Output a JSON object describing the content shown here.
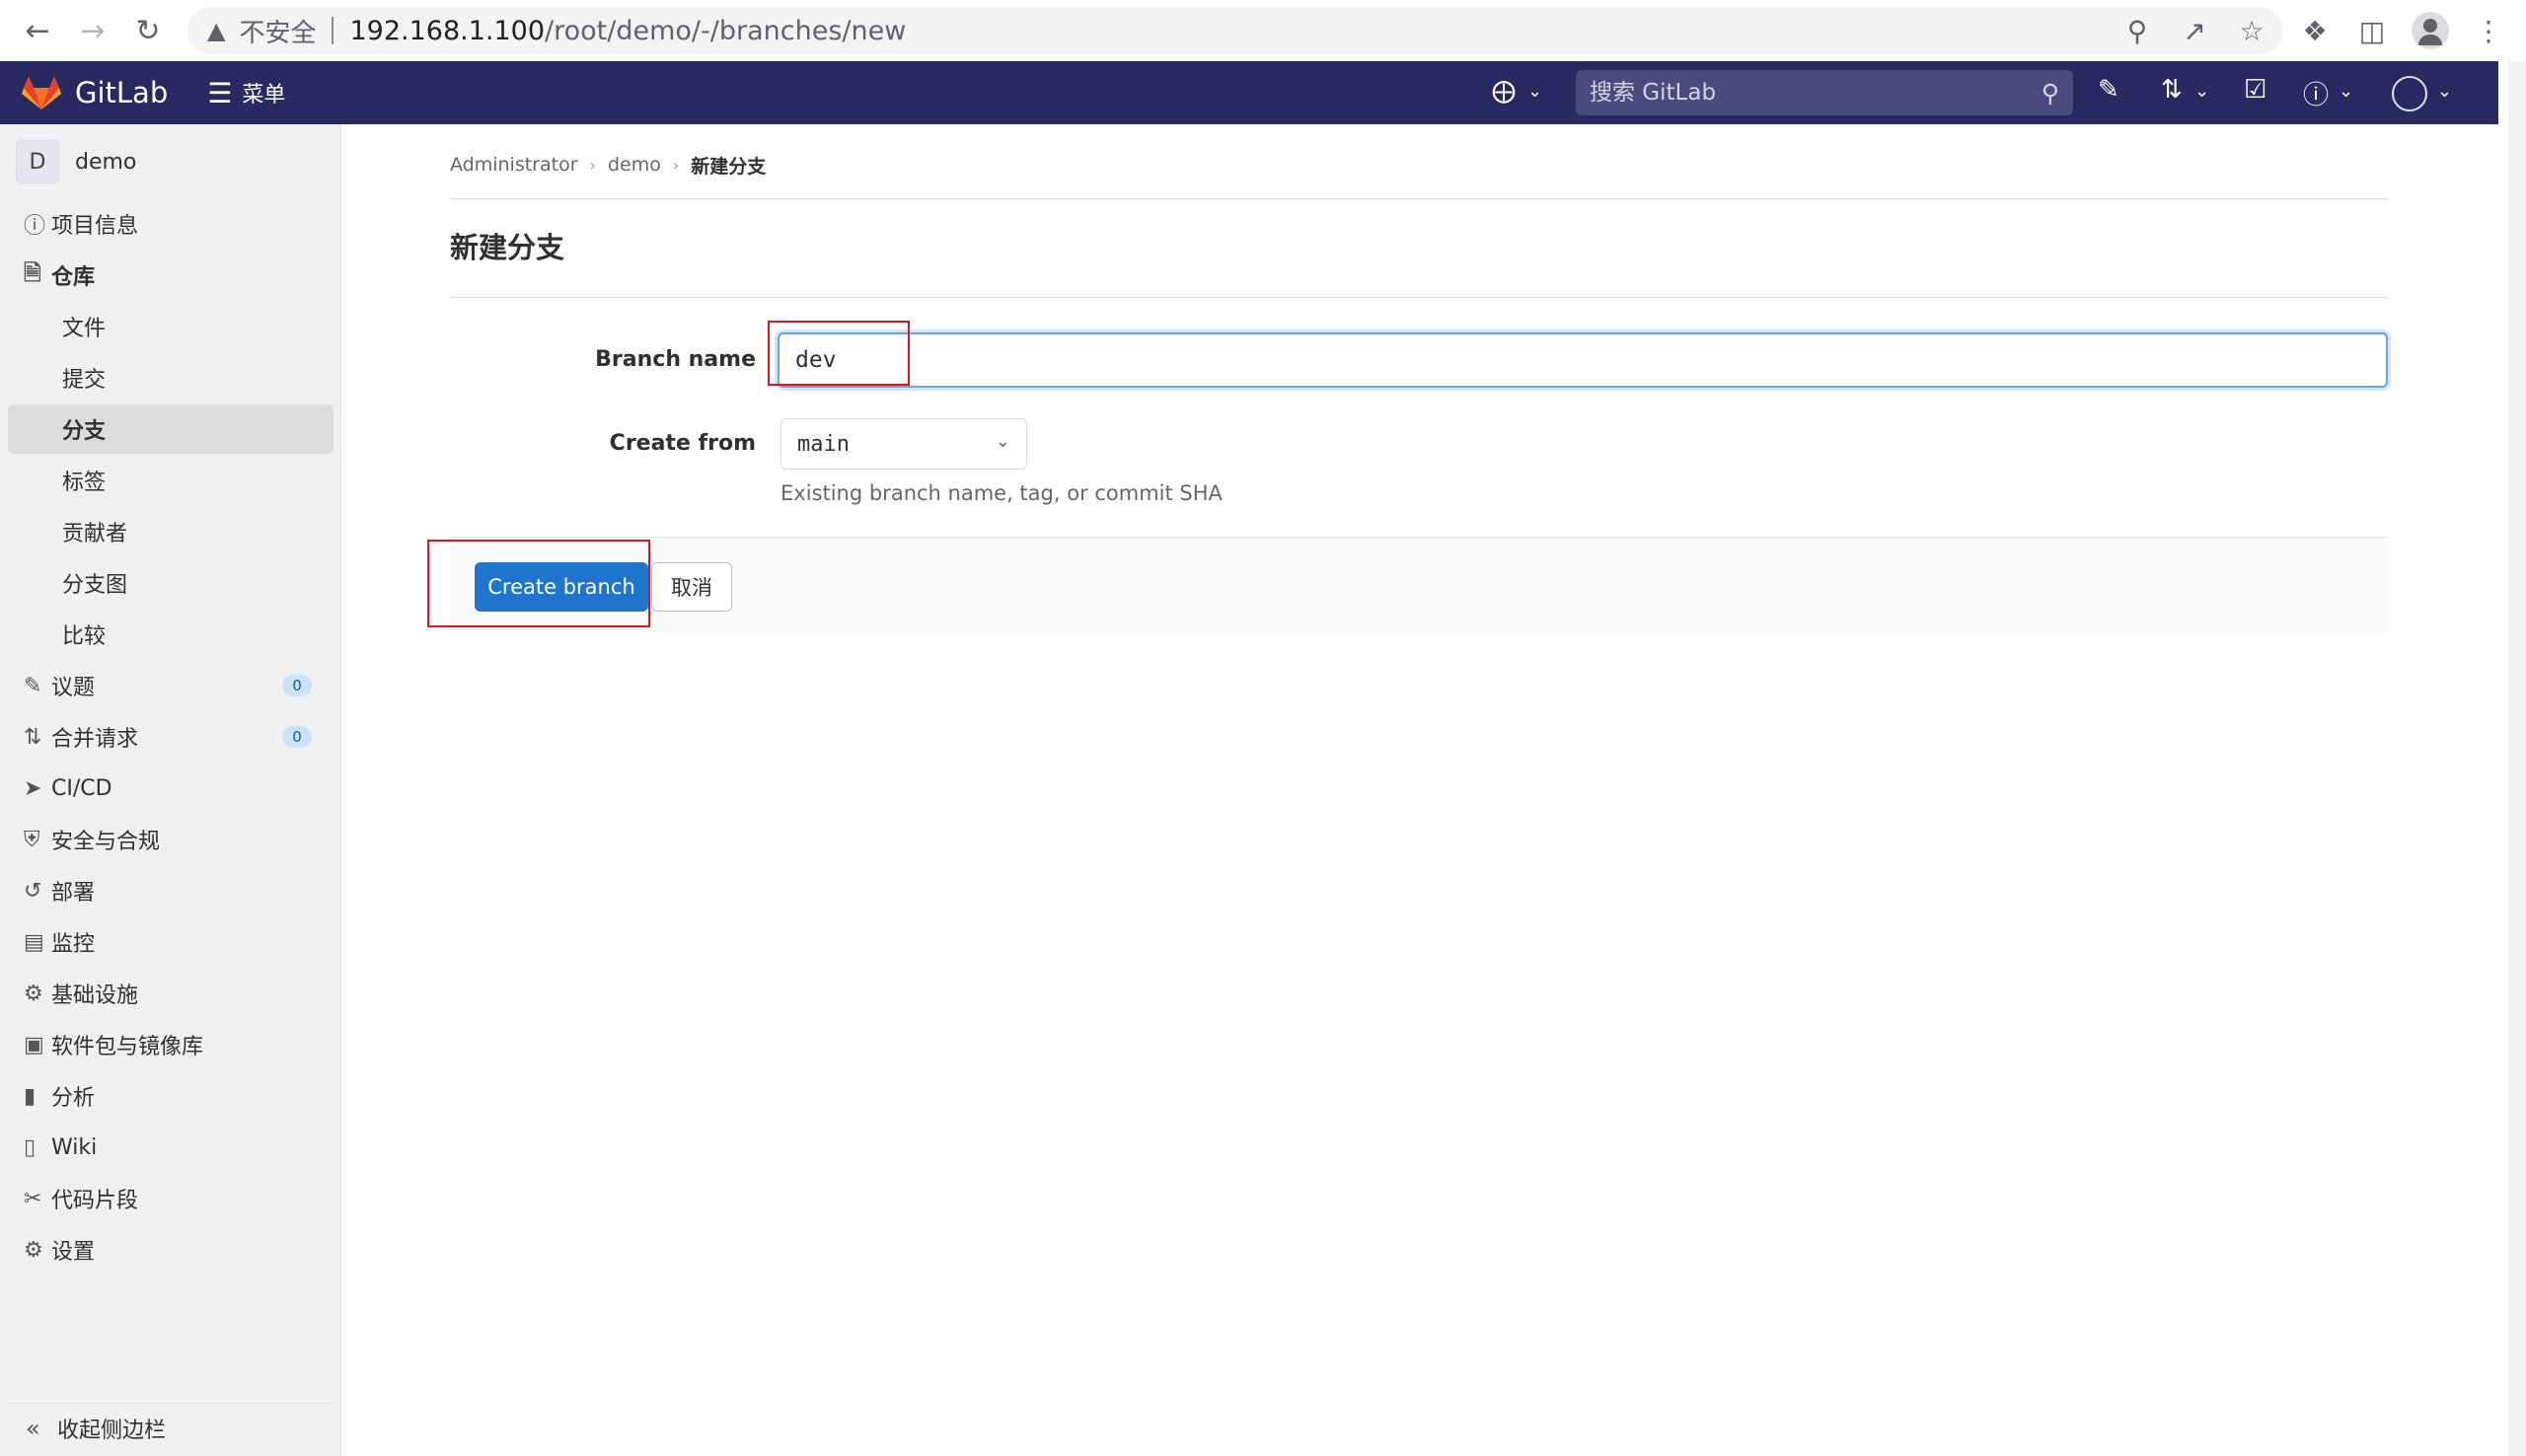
{
  "browser": {
    "insecure_label": "不安全",
    "url_host": "192.168.1.100",
    "url_path": "/root/demo/-/branches/new"
  },
  "topbar": {
    "brand": "GitLab",
    "menu_label": "菜单",
    "search_placeholder": "搜索 GitLab"
  },
  "sidebar": {
    "project_initial": "D",
    "project_name": "demo",
    "items": [
      {
        "label": "项目信息",
        "icon": "info-icon"
      },
      {
        "label": "仓库",
        "icon": "repository-icon"
      },
      {
        "label": "文件"
      },
      {
        "label": "提交"
      },
      {
        "label": "分支"
      },
      {
        "label": "标签"
      },
      {
        "label": "贡献者"
      },
      {
        "label": "分支图"
      },
      {
        "label": "比较"
      },
      {
        "label": "议题",
        "icon": "issues-icon",
        "badge": "0"
      },
      {
        "label": "合并请求",
        "icon": "merge-request-icon",
        "badge": "0"
      },
      {
        "label": "CI/CD",
        "icon": "rocket-icon"
      },
      {
        "label": "安全与合规",
        "icon": "shield-icon"
      },
      {
        "label": "部署",
        "icon": "deploy-icon"
      },
      {
        "label": "监控",
        "icon": "monitor-icon"
      },
      {
        "label": "基础设施",
        "icon": "cloud-gear-icon"
      },
      {
        "label": "软件包与镜像库",
        "icon": "package-icon"
      },
      {
        "label": "分析",
        "icon": "chart-icon"
      },
      {
        "label": "Wiki",
        "icon": "book-icon"
      },
      {
        "label": "代码片段",
        "icon": "snippet-icon"
      },
      {
        "label": "设置",
        "icon": "gear-icon"
      }
    ],
    "collapse_label": "收起侧边栏"
  },
  "breadcrumb": [
    "Administrator",
    "demo",
    "新建分支"
  ],
  "page": {
    "title": "新建分支",
    "branch_name_label": "Branch name",
    "branch_name_value": "dev",
    "create_from_label": "Create from",
    "create_from_value": "main",
    "create_from_help": "Existing branch name, tag, or commit SHA",
    "create_button": "Create branch",
    "cancel_button": "取消"
  },
  "colors": {
    "topbar": "#292961",
    "primary": "#1f75cb",
    "highlight": "#e0141e"
  }
}
